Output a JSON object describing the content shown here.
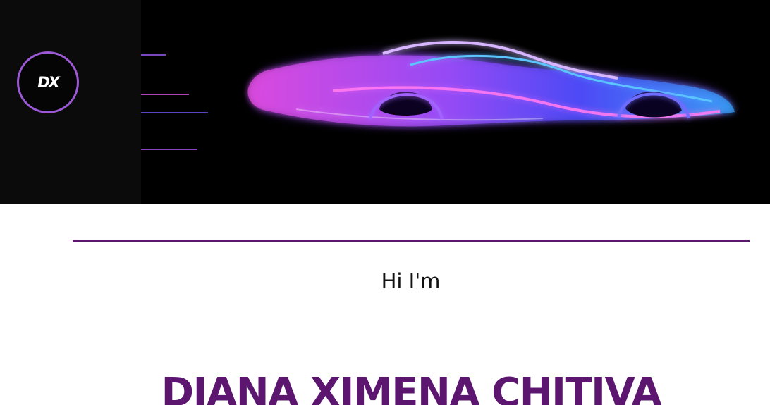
{
  "header": {
    "logo": {
      "text": "DX",
      "border_color": "#9b59d6"
    },
    "hero_image": {
      "icon": "neon-sports-car-image"
    }
  },
  "main": {
    "greeting": "Hi I'm",
    "name": "DIANA XIMENA CHITIVA"
  },
  "colors": {
    "accent": "#5c1670",
    "header_background": "#000000",
    "logo_panel": "#0b0b0b"
  }
}
